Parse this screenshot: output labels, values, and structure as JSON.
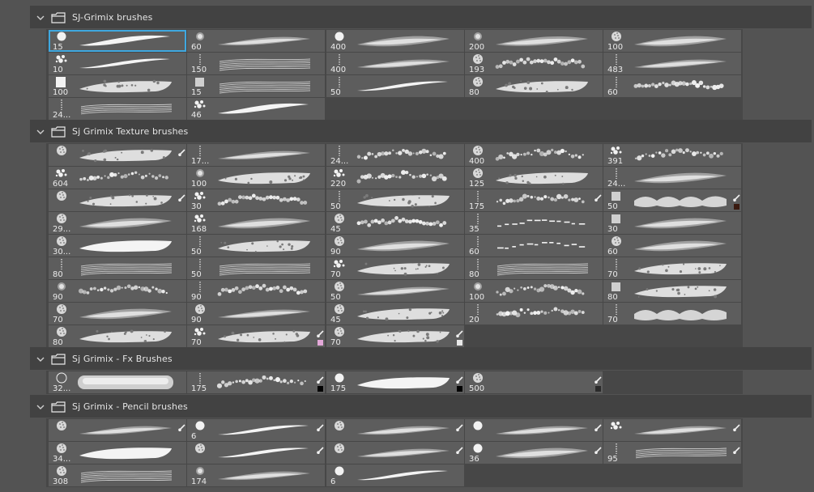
{
  "brush_panel": {
    "colors": {
      "background": "#535353",
      "header": "#424242",
      "group_bg": "#474747",
      "tile": "#5d5d5d",
      "selection": "#3fa8e0",
      "text": "#eaeaea"
    },
    "groups": [
      {
        "name": "SJ-Grimix brushes",
        "items": [
          {
            "size": "15",
            "tip": "round-hard",
            "stroke": "taper",
            "selected": true
          },
          {
            "size": "60",
            "tip": "round-soft",
            "stroke": "soft-taper"
          },
          {
            "size": "400",
            "tip": "round-hard",
            "stroke": "soft-wide"
          },
          {
            "size": "200",
            "tip": "round-soft",
            "stroke": "airbrush"
          },
          {
            "size": "100",
            "tip": "textured",
            "stroke": "soft-wide"
          },
          {
            "size": "10",
            "tip": "splatter",
            "stroke": "thin-taper"
          },
          {
            "size": "150",
            "tip": "stroke-line",
            "stroke": "wispy"
          },
          {
            "size": "400",
            "tip": "stroke-line",
            "stroke": "soft-taper"
          },
          {
            "size": "193",
            "tip": "textured",
            "stroke": "dotted-chain"
          },
          {
            "size": "483",
            "tip": "stroke-line",
            "stroke": "soft-taper"
          },
          {
            "size": "100",
            "tip": "square",
            "stroke": "rough-wide"
          },
          {
            "size": "15",
            "tip": "square-soft",
            "stroke": "wispy"
          },
          {
            "size": "50",
            "tip": "stroke-line",
            "stroke": "thin-taper"
          },
          {
            "size": "80",
            "tip": "textured",
            "stroke": "rough-wide"
          },
          {
            "size": "60",
            "tip": "stroke-line",
            "stroke": "speckle"
          },
          {
            "size": "24...",
            "tip": "stroke-line",
            "stroke": "multi-line"
          },
          {
            "size": "46",
            "tip": "splatter",
            "stroke": "taper"
          }
        ]
      },
      {
        "name": "Sj Grimix Texture brushes",
        "items": [
          {
            "size": "",
            "tip": "textured",
            "stroke": "rough-wide",
            "icon": true
          },
          {
            "size": "17...",
            "tip": "stroke-line",
            "stroke": "soft-taper"
          },
          {
            "size": "24...",
            "tip": "stroke-line",
            "stroke": "speckle"
          },
          {
            "size": "400",
            "tip": "textured",
            "stroke": "speckle"
          },
          {
            "size": "391",
            "tip": "splatter",
            "stroke": "speckle"
          },
          {
            "size": "604",
            "tip": "splatter",
            "stroke": "speckle"
          },
          {
            "size": "100",
            "tip": "round-soft",
            "stroke": "rough-wide"
          },
          {
            "size": "220",
            "tip": "splatter",
            "stroke": "speckle"
          },
          {
            "size": "125",
            "tip": "textured",
            "stroke": "rough-wide"
          },
          {
            "size": "24...",
            "tip": "stroke-line",
            "stroke": "soft-wide"
          },
          {
            "size": "",
            "tip": "textured",
            "stroke": "rough-wide",
            "icon": true
          },
          {
            "size": "30",
            "tip": "splatter",
            "stroke": "dotted-chain"
          },
          {
            "size": "50",
            "tip": "stroke-line",
            "stroke": "rough-wide"
          },
          {
            "size": "175",
            "tip": "stroke-line",
            "stroke": "speckle",
            "icon": true
          },
          {
            "size": "50",
            "tip": "square-soft",
            "stroke": "scallop",
            "icon": true,
            "swatch": "#3a1a10"
          },
          {
            "size": "29...",
            "tip": "textured",
            "stroke": "soft-wide"
          },
          {
            "size": "168",
            "tip": "splatter",
            "stroke": "soft-wide"
          },
          {
            "size": "45",
            "tip": "textured",
            "stroke": "dotted-chain"
          },
          {
            "size": "35",
            "tip": "stroke-line",
            "stroke": "dashes"
          },
          {
            "size": "30",
            "tip": "square-soft",
            "stroke": "soft-wide"
          },
          {
            "size": "30...",
            "tip": "textured",
            "stroke": "bold-wide"
          },
          {
            "size": "50",
            "tip": "stroke-line",
            "stroke": "rough-wide"
          },
          {
            "size": "90",
            "tip": "textured",
            "stroke": "soft-wide"
          },
          {
            "size": "60",
            "tip": "stroke-line",
            "stroke": "dashes"
          },
          {
            "size": "60",
            "tip": "textured",
            "stroke": "soft-wide"
          },
          {
            "size": "80",
            "tip": "stroke-line",
            "stroke": "wispy"
          },
          {
            "size": "50",
            "tip": "stroke-line",
            "stroke": "wispy"
          },
          {
            "size": "70",
            "tip": "splatter",
            "stroke": "rough-wide"
          },
          {
            "size": "80",
            "tip": "stroke-line",
            "stroke": "wispy"
          },
          {
            "size": "70",
            "tip": "stroke-line",
            "stroke": "rough-wide"
          },
          {
            "size": "90",
            "tip": "round-soft",
            "stroke": "speckle"
          },
          {
            "size": "90",
            "tip": "stroke-line",
            "stroke": "dotted-chain"
          },
          {
            "size": "50",
            "tip": "textured",
            "stroke": "soft-taper"
          },
          {
            "size": "100",
            "tip": "round-soft",
            "stroke": "speckle"
          },
          {
            "size": "80",
            "tip": "square-soft",
            "stroke": "rough-wide"
          },
          {
            "size": "70",
            "tip": "textured",
            "stroke": "soft-wide"
          },
          {
            "size": "90",
            "tip": "textured",
            "stroke": "soft-taper"
          },
          {
            "size": "45",
            "tip": "textured",
            "stroke": "rough-wide"
          },
          {
            "size": "20",
            "tip": "stroke-line",
            "stroke": "speckle"
          },
          {
            "size": "70",
            "tip": "stroke-line",
            "stroke": "scallop"
          },
          {
            "size": "80",
            "tip": "textured",
            "stroke": "rough-wide"
          },
          {
            "size": "70",
            "tip": "splatter",
            "stroke": "rough-wide",
            "icon": true,
            "swatch": "#e3a8d8"
          },
          {
            "size": "70",
            "tip": "textured",
            "stroke": "rough-wide",
            "icon": true,
            "swatch": "#e8e8e8"
          }
        ]
      },
      {
        "name": "Sj Grimix - Fx  Brushes",
        "items": [
          {
            "size": "32...",
            "tip": "ring",
            "stroke": "tube"
          },
          {
            "size": "175",
            "tip": "stroke-line",
            "stroke": "speckle",
            "icon": true,
            "swatch": "#000000"
          },
          {
            "size": "175",
            "tip": "round-hard",
            "stroke": "bold-wide",
            "icon": true,
            "swatch": "#000000"
          },
          {
            "size": "500",
            "tip": "textured",
            "stroke": "none",
            "icon": true,
            "swatch": "#2a2a2a"
          }
        ]
      },
      {
        "name": "Sj Grimix - Pencil brushes",
        "items": [
          {
            "size": "",
            "tip": "textured",
            "stroke": "soft-taper",
            "icon": true
          },
          {
            "size": "6",
            "tip": "round-hard",
            "stroke": "thin-taper",
            "icon": true
          },
          {
            "size": "",
            "tip": "textured",
            "stroke": "soft-taper",
            "icon": true
          },
          {
            "size": "",
            "tip": "round-hard",
            "stroke": "soft-taper",
            "icon": true
          },
          {
            "size": "",
            "tip": "splatter",
            "stroke": "soft-taper",
            "icon": true
          },
          {
            "size": "34...",
            "tip": "textured",
            "stroke": "bold-wide"
          },
          {
            "size": "",
            "tip": "textured",
            "stroke": "thin-taper",
            "icon": true
          },
          {
            "size": "",
            "tip": "textured",
            "stroke": "soft-taper",
            "icon": true
          },
          {
            "size": "36",
            "tip": "round-hard",
            "stroke": "soft-wide",
            "icon": true
          },
          {
            "size": "95",
            "tip": "stroke-line",
            "stroke": "multi-line",
            "icon": true
          },
          {
            "size": "308",
            "tip": "textured",
            "stroke": "wispy"
          },
          {
            "size": "174",
            "tip": "round-soft",
            "stroke": "soft-taper"
          },
          {
            "size": "6",
            "tip": "round-hard",
            "stroke": "thin-taper"
          }
        ]
      }
    ]
  }
}
